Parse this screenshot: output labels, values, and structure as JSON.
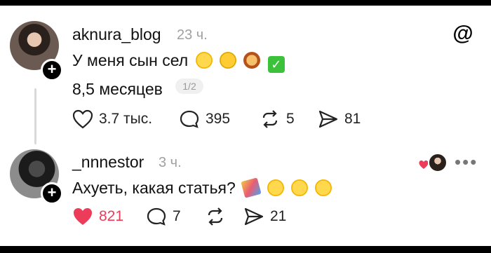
{
  "post1": {
    "username": "aknura_blog",
    "time": "23 ч.",
    "text": "У меня сын сел",
    "text2": "8,5 месяцев",
    "page": "1/2",
    "likes": "3.7 тыс.",
    "replies": "395",
    "reposts": "5",
    "shares": "81",
    "emojis": [
      "pleading-face",
      "hand-over-mouth-face",
      "lion-face",
      "check-mark"
    ]
  },
  "post2": {
    "username": "_nnnestor",
    "time": "3 ч.",
    "text": "Ахуеть, какая статья?",
    "likes": "821",
    "replies": "7",
    "shares": "21",
    "emojis": [
      "party-popper",
      "pleading-face",
      "pleading-face",
      "pleading-face"
    ]
  },
  "colors": {
    "liked": "#ed3b5a",
    "muted": "#a0a0a0",
    "text": "#111111"
  }
}
